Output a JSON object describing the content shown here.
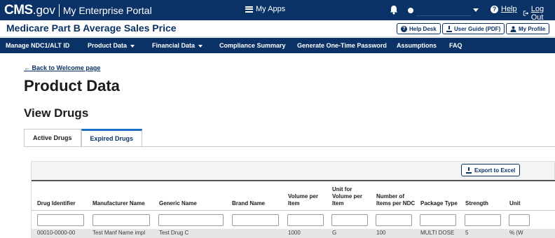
{
  "topbar": {
    "brand_cms": "CMS",
    "brand_gov": ".gov",
    "portal": "My Enterprise Portal",
    "my_apps": "My Apps",
    "help": "Help",
    "logout": "Log Out",
    "help_glyph": "?",
    "icons": [
      "grid-icon",
      "bell-icon",
      "user-icon",
      "help-icon",
      "logout-icon"
    ]
  },
  "titlebar": {
    "title": "Medicare Part B Average Sales Price",
    "help_desk": "Help Desk",
    "user_guide": "User Guide (PDF)",
    "my_profile": "My Profile"
  },
  "nav": {
    "items": [
      {
        "label": "Manage NDC1/ALT ID"
      },
      {
        "label": "Product Data"
      },
      {
        "label": "Financial Data"
      },
      {
        "label": "Compliance Summary"
      },
      {
        "label": "Generate One-Time Password"
      },
      {
        "label": "Assumptions"
      },
      {
        "label": "FAQ"
      }
    ]
  },
  "main": {
    "back_link": "← Back to Welcome page",
    "page_title": "Product Data",
    "section_title": "View Drugs",
    "tabs": [
      {
        "label": "Active Drugs"
      },
      {
        "label": "Expired Drugs",
        "active": true
      }
    ],
    "export_label": "Export to Excel"
  },
  "table": {
    "headers": [
      "Drug Identifier",
      "Manufacturer Name",
      "Generic Name",
      "Brand Name",
      "Volume per Item",
      "Unit for Volume per Item",
      "Number of Items per NDC",
      "Package Type",
      "Strength",
      "Unit"
    ],
    "rows": [
      [
        "00010-0000-00",
        "Test Manf Name impl",
        "Test Drug C",
        "",
        "1000",
        "G",
        "100",
        "MULTI DOSE",
        "5",
        "% (W"
      ]
    ]
  },
  "colors": {
    "navy": "#0b3266",
    "tab_accent": "#1a6ec4"
  }
}
